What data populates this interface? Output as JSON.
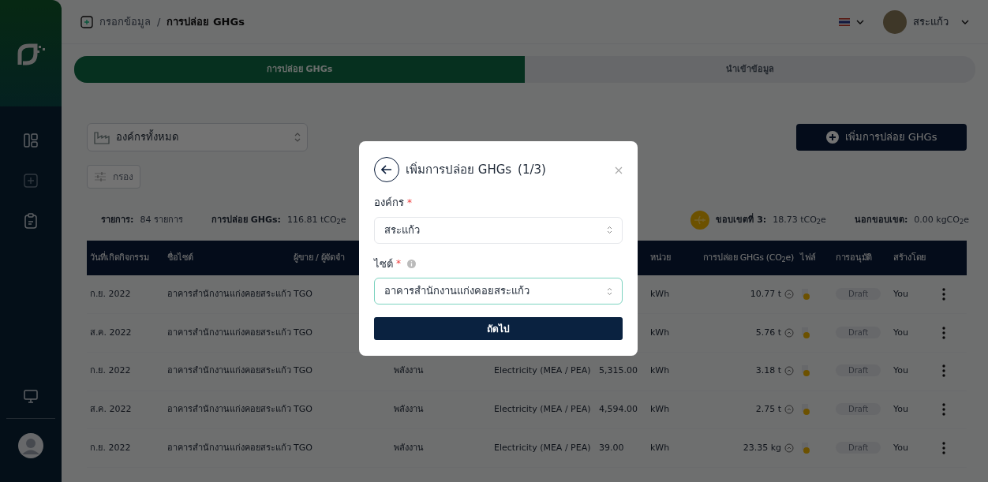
{
  "breadcrumb": [
    {
      "label": "กรอกข้อมูล",
      "current": false
    },
    {
      "label": "การปล่อย GHGs",
      "current": true
    }
  ],
  "breadcrumb_separator": "/",
  "user": {
    "name": "สระแก้ว"
  },
  "tabs": [
    {
      "label": "การปล่อย GHGs",
      "selected": true
    },
    {
      "label": "นำเข้าข้อมูล",
      "selected": false
    }
  ],
  "organization_select": {
    "value": "องค์กรทั้งหมด"
  },
  "add_button": "เพิ่มการปล่อย GHGs",
  "filter_button": "กรอง",
  "summary": [
    {
      "label": "รายการ:",
      "value": "84 รายการ"
    },
    {
      "label": "การปล่อย GHGs:",
      "value": "116.81 tCO$_{2}$e"
    },
    {
      "label": "ขอบเขตที่ 3:",
      "value": "18.73 tCO$_{2}$e",
      "kind": "scope"
    },
    {
      "label": "นอกขอบเขต:",
      "value": "0.00 kgCO$_{2}$e"
    }
  ],
  "table": {
    "columns": [
      "วันที่เกิดกิจกรรม",
      "ชื่อไซต์",
      "ผู้ขาย / ผู้จัดจำ",
      null,
      null,
      null,
      "หน่วย",
      "การปล่อย GHGs (CO$_{2}$e)",
      "ไฟล์",
      "การอนุมัติ",
      "สร้างโดย"
    ],
    "rows": [
      {
        "date": "ก.ย. 2022",
        "site": "อาคารสำนักงานแก่งคอยสระแก้ว",
        "vendor": "TGO",
        "unit": "kWh",
        "emission": "10.77 t",
        "approval": "Draft",
        "created_by": "You"
      },
      {
        "date": "ส.ค. 2022",
        "site": "อาคารสำนักงานแก่งคอยสระแก้ว",
        "vendor": "TGO",
        "unit": "kWh",
        "emission": "5.76 t",
        "approval": "Draft",
        "created_by": "You"
      },
      {
        "date": "ก.ย. 2022",
        "site": "อาคารสำนักงานแก่งคอยสระแก้ว",
        "vendor": "TGO",
        "category": "พลังงาน",
        "type": "Electricity (MEA / PEA)",
        "quantity": "5,315.00",
        "unit": "kWh",
        "emission": "3.18 t",
        "approval": "Draft",
        "created_by": "You"
      },
      {
        "date": "ส.ค. 2022",
        "site": "อาคารสำนักงานแก่งคอยสระแก้ว",
        "vendor": "TGO",
        "category": "พลังงาน",
        "type": "Electricity (MEA / PEA)",
        "quantity": "4,594.00",
        "unit": "kWh",
        "emission": "2.75 t",
        "approval": "Draft",
        "created_by": "You"
      },
      {
        "date": "ก.ย. 2022",
        "site": "อาคารสำนักงานแก่งคอยสระแก้ว",
        "vendor": "TGO",
        "category": "พลังงาน",
        "type": "Electricity (MEA / PEA)",
        "quantity": "39.00",
        "unit": "kWh",
        "emission": "23.35 kg",
        "approval": "Draft",
        "created_by": "You"
      }
    ]
  },
  "modal": {
    "title": "เพิ่มการปล่อย GHGs",
    "step": "(1/3)",
    "fields": [
      {
        "label": "องค์กร",
        "required": true,
        "required_mark": "*",
        "info": false,
        "value": "สระแก้ว",
        "focused": false
      },
      {
        "label": "ไซต์",
        "required": true,
        "required_mark": "*",
        "info": true,
        "value": "อาคารสำนักงานแก่งคอยสระแก้ว",
        "focused": true
      }
    ],
    "next_button": "ถัดไป"
  }
}
